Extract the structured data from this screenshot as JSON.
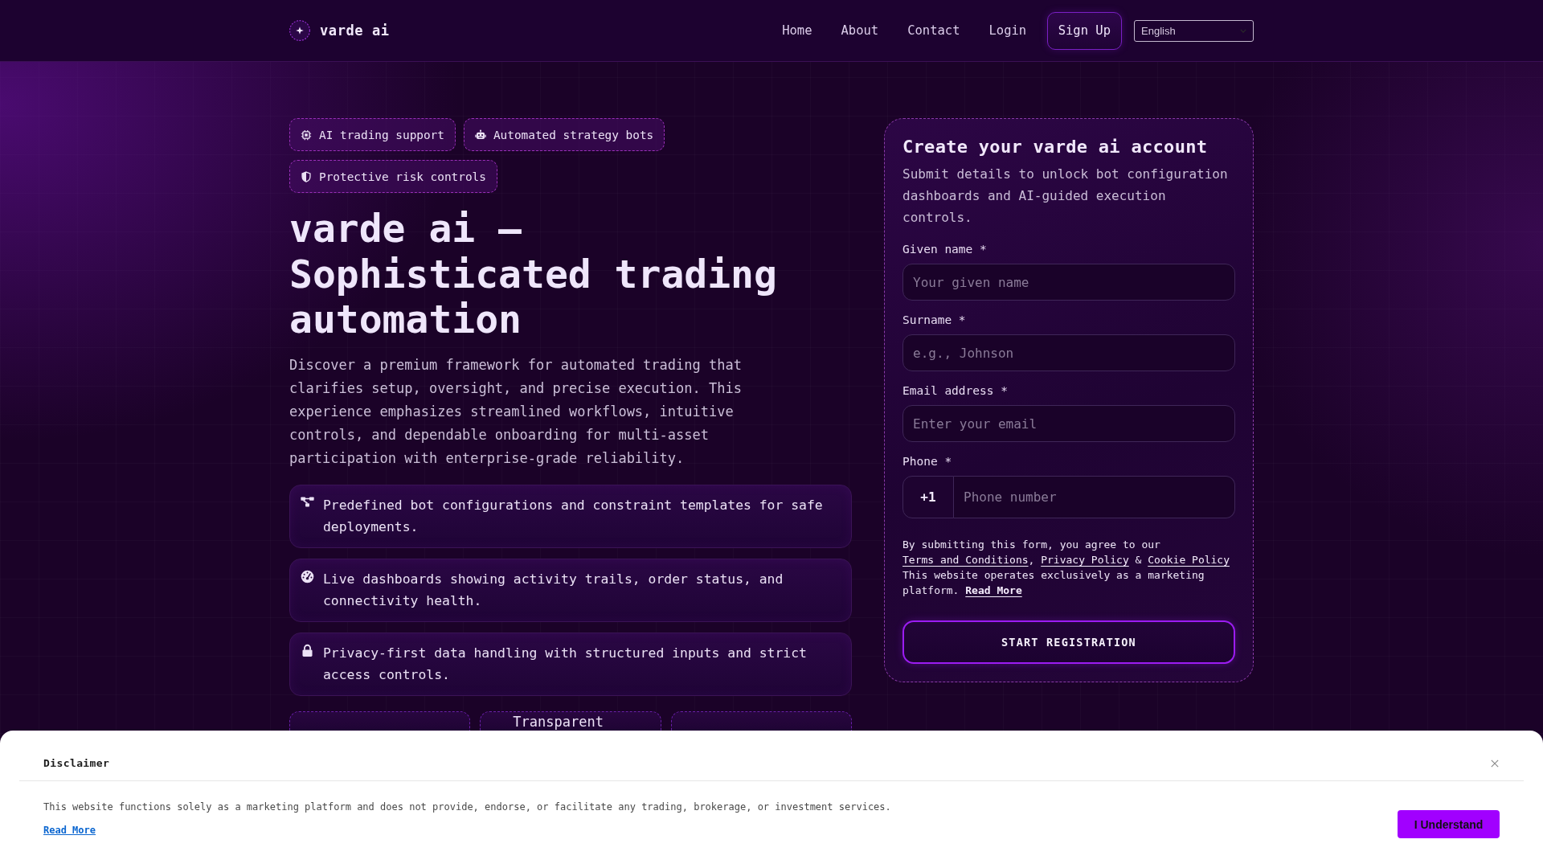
{
  "header": {
    "brand": "varde ai",
    "nav": [
      "Home",
      "About",
      "Contact",
      "Login"
    ],
    "signup": "Sign Up",
    "language": "English"
  },
  "hero": {
    "tags": [
      "AI trading support",
      "Automated strategy bots",
      "Protective risk controls"
    ],
    "title": "varde ai — Sophisticated trading automation",
    "description": "Discover a premium framework for automated trading that clarifies setup, oversight, and precise execution. This experience emphasizes streamlined workflows, intuitive controls, and dependable onboarding for multi-asset participation with enterprise-grade reliability.",
    "features": [
      "Predefined bot configurations and constraint templates for safe deployments.",
      "Live dashboards showing activity trails, order status, and connectivity health.",
      "Privacy-first data handling with structured inputs and strict access controls."
    ],
    "highlight_cards": [
      {
        "kind": "blank"
      },
      {
        "kind": "titled",
        "title": "Transparent"
      },
      {
        "kind": "blank"
      }
    ]
  },
  "form": {
    "title": "Create your varde ai account",
    "subtitle": "Submit details to unlock bot configuration dashboards and AI-guided execution controls.",
    "fields": [
      {
        "kind": "text",
        "label": "Given name *",
        "placeholder": "Your given name"
      },
      {
        "kind": "text",
        "label": "Surname *",
        "placeholder": "e.g., Johnson"
      },
      {
        "kind": "text",
        "label": "Email address *",
        "placeholder": "Enter your email"
      },
      {
        "kind": "phone",
        "label": "Phone *",
        "prefix": "+1",
        "placeholder": "Phone number"
      }
    ],
    "consent": [
      {
        "kind": "text",
        "text": "By submitting this form, you agree to our "
      },
      {
        "kind": "link",
        "text": "Terms and Conditions"
      },
      {
        "kind": "text",
        "text": ", "
      },
      {
        "kind": "link",
        "text": "Privacy Policy"
      },
      {
        "kind": "text",
        "text": " & "
      },
      {
        "kind": "link",
        "text": "Cookie Policy"
      },
      {
        "kind": "text",
        "text": " This website operates exclusively as a marketing platform. "
      },
      {
        "kind": "strong-link",
        "text": "Read More"
      }
    ],
    "submit": "START REGISTRATION"
  },
  "disclaimer": {
    "title": "Disclaimer",
    "text": "This website functions solely as a marketing platform and does not provide, endorse, or facilitate any trading, brokerage, or investment services.",
    "link": "Read More",
    "button": "I Understand"
  }
}
